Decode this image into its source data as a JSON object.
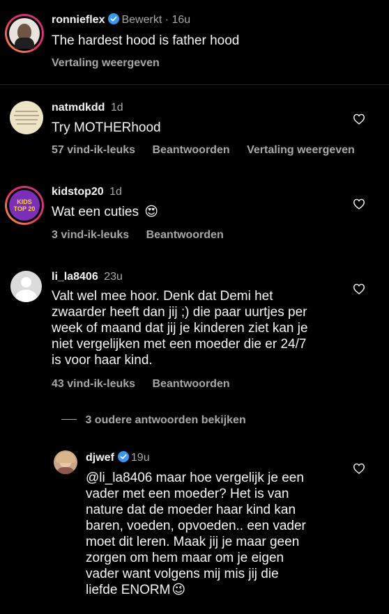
{
  "post": {
    "username": "ronnieflex",
    "edited_time": "Bewerkt · 16u",
    "text": "The hardest hood is father hood",
    "translate": "Vertaling weergeven"
  },
  "comments": [
    {
      "username": "natmdkdd",
      "time": "1d",
      "text": "Try MOTHERhood",
      "likes": "57 vind-ik-leuks",
      "reply": "Beantwoorden",
      "translate": "Vertaling weergeven"
    },
    {
      "username": "kidstop20",
      "time": "1d",
      "text": "Wat een cuties",
      "emoji": "😍",
      "likes": "3 vind-ik-leuks",
      "reply": "Beantwoorden",
      "avatar_text": "KIDS TOP 20"
    },
    {
      "username": "li_la8406",
      "time": "23u",
      "text_lines": [
        "Valt wel mee hoor. Denk dat Demi het",
        "zwaarder heeft dan jij ;) die paar uurtjes per",
        "week of maand dat jij je kinderen ziet kan je",
        "niet vergelijken met een moeder die er 24/7",
        "is voor haar kind."
      ],
      "likes": "43 vind-ik-leuks",
      "reply": "Beantwoorden"
    }
  ],
  "view_replies": "3 oudere antwoorden bekijken",
  "reply": {
    "username": "djwef",
    "time": "19u",
    "text_lines": [
      "@li_la8406 maar hoe vergelijk je een",
      "vader met een moeder? Het is van",
      "nature dat de moeder haar kind kan",
      "baren, voeden, opvoeden.. een vader",
      "moet dit leren. Maak jij je maar geen",
      "zorgen om hem maar om je eigen",
      "vader want volgens mij mis jij die",
      "liefde ENORM"
    ],
    "emoji": "😉"
  },
  "colors": {
    "background": "#000000",
    "verified": "#3897f0",
    "secondary_text": "#a8a8a8"
  }
}
